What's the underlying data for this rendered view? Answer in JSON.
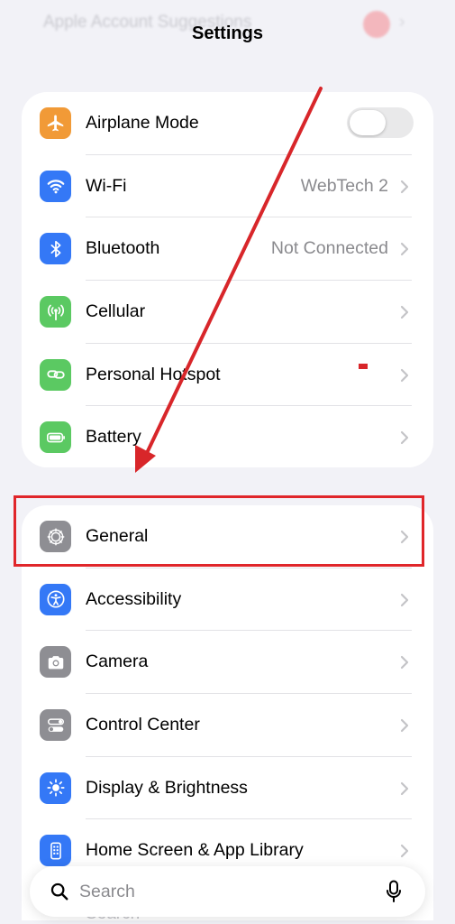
{
  "header": {
    "title": "Settings",
    "ghost_above": "Apple Account Suggestions",
    "ghost_below": "Search"
  },
  "groups": [
    {
      "rows": [
        {
          "label": "Airplane Mode",
          "icon": "airplane-icon",
          "color": "#f19a37",
          "toggle": true,
          "toggle_on": false
        },
        {
          "label": "Wi-Fi",
          "icon": "wifi-icon",
          "color": "#3478f6",
          "value": "WebTech 2"
        },
        {
          "label": "Bluetooth",
          "icon": "bluetooth-icon",
          "color": "#3478f6",
          "value": "Not Connected"
        },
        {
          "label": "Cellular",
          "icon": "cellular-icon",
          "color": "#5bc962"
        },
        {
          "label": "Personal Hotspot",
          "icon": "hotspot-icon",
          "color": "#5bc962"
        },
        {
          "label": "Battery",
          "icon": "battery-icon",
          "color": "#5bc962"
        }
      ]
    },
    {
      "rows": [
        {
          "label": "General",
          "icon": "gear-icon",
          "color": "#8e8e93"
        },
        {
          "label": "Accessibility",
          "icon": "accessibility-icon",
          "color": "#3478f6"
        },
        {
          "label": "Camera",
          "icon": "camera-icon",
          "color": "#8e8e93"
        },
        {
          "label": "Control Center",
          "icon": "control-center-icon",
          "color": "#8e8e93"
        },
        {
          "label": "Display & Brightness",
          "icon": "brightness-icon",
          "color": "#3478f6"
        },
        {
          "label": "Home Screen & App Library",
          "icon": "home-screen-icon",
          "color": "#3478f6"
        }
      ]
    }
  ],
  "search": {
    "placeholder": "Search"
  },
  "annotation": {
    "color": "#e0262a",
    "highlighted_row": "General"
  }
}
